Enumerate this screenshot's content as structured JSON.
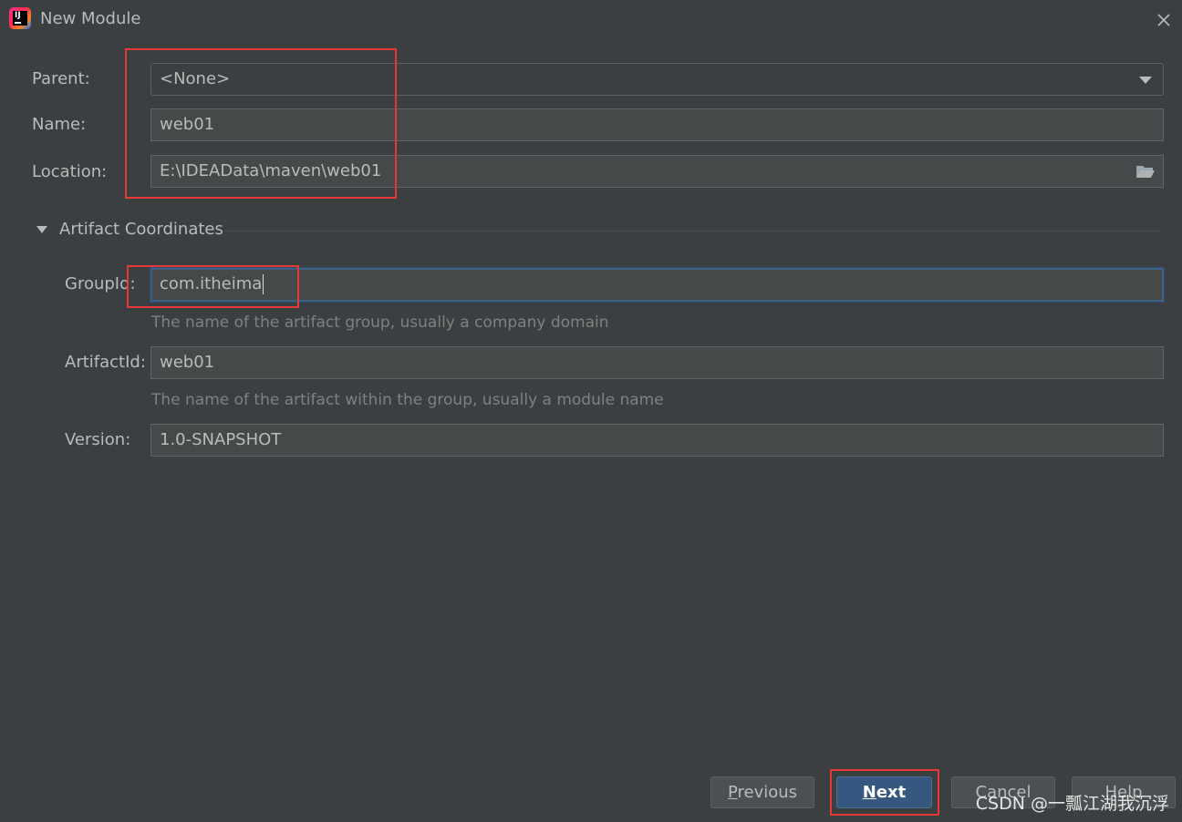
{
  "window": {
    "title": "New Module",
    "close_icon": "close-icon"
  },
  "form": {
    "parent": {
      "label": "Parent:",
      "value": "<None>"
    },
    "name": {
      "label": "Name:",
      "value": "web01"
    },
    "location": {
      "label": "Location:",
      "value": "E:\\IDEAData\\maven\\web01"
    }
  },
  "artifact": {
    "section_title": "Artifact Coordinates",
    "group_id": {
      "label": "GroupId:",
      "value": "com.itheima",
      "hint": "The name of the artifact group, usually a company domain"
    },
    "artifact_id": {
      "label": "ArtifactId:",
      "value": "web01",
      "hint": "The name of the artifact within the group, usually a module name"
    },
    "version": {
      "label": "Version:",
      "value": "1.0-SNAPSHOT"
    }
  },
  "buttons": {
    "previous": {
      "mnemonic": "P",
      "rest": "revious"
    },
    "next": {
      "mnemonic": "N",
      "rest": "ext"
    },
    "cancel": {
      "mnemonic": "",
      "rest": "Cancel"
    },
    "help": {
      "mnemonic": "",
      "rest": "Help"
    }
  },
  "watermark": "CSDN @一瓢江湖我沉浮",
  "colors": {
    "background": "#3c3f41",
    "field_bg": "#45494a",
    "focus_border": "#3d6185",
    "default_button": "#365880",
    "annotation_red": "#e53935"
  }
}
